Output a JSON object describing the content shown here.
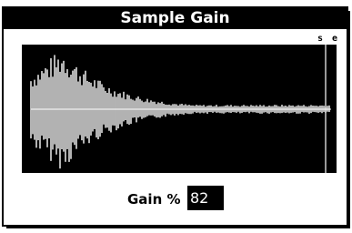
{
  "dialog": {
    "title": "Sample Gain",
    "marker_labels": "s e",
    "gain": {
      "label": "Gain %",
      "value": "82"
    }
  },
  "colors": {
    "background": "#ffffff",
    "foreground": "#000000",
    "waveform": "#ffffff"
  }
}
